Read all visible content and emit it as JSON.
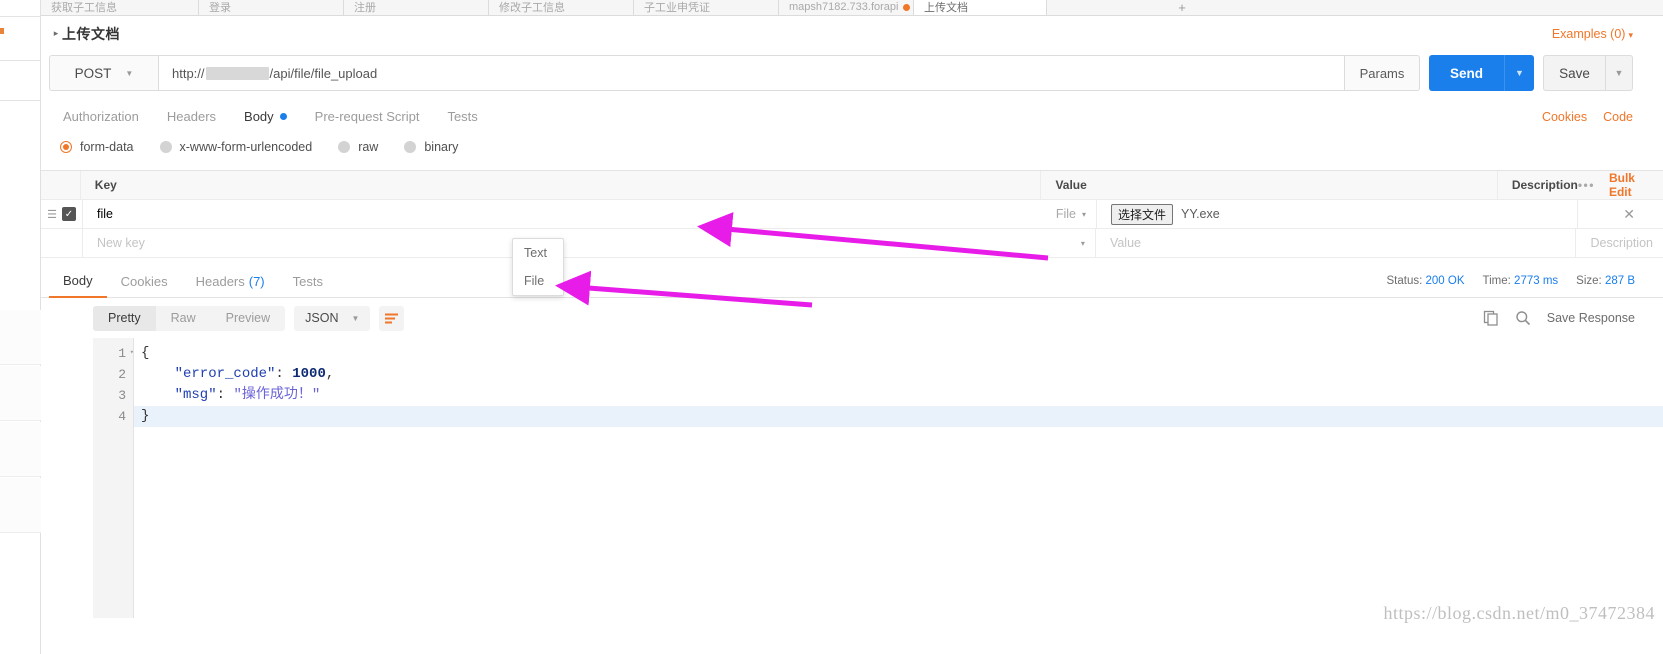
{
  "tabstrip": {
    "tabs": [
      {
        "label": "获取子工信息",
        "active": false,
        "dirty": false
      },
      {
        "label": "登录",
        "active": false,
        "dirty": false
      },
      {
        "label": "注册",
        "active": false,
        "dirty": false
      },
      {
        "label": "修改子工信息",
        "active": false,
        "dirty": false
      },
      {
        "label": "子工业申凭证",
        "active": false,
        "dirty": false
      },
      {
        "label": "mapsh7182.733.forapi",
        "active": false,
        "dirty": true
      },
      {
        "label": "上传文档",
        "active": true,
        "dirty": false
      }
    ],
    "add_tab_label": "+"
  },
  "request": {
    "title": "上传文档",
    "collapse_caret": "▸",
    "examples_label": "Examples (0)",
    "examples_caret": "▾",
    "method": "POST",
    "url_prefix": "http://",
    "url_suffix": "/api/file/file_upload",
    "params_label": "Params",
    "send_label": "Send",
    "save_label": "Save",
    "tabs": [
      {
        "label": "Authorization",
        "active": false,
        "dot": false
      },
      {
        "label": "Headers",
        "active": false,
        "dot": false
      },
      {
        "label": "Body",
        "active": true,
        "dot": true
      },
      {
        "label": "Pre-request Script",
        "active": false,
        "dot": false
      },
      {
        "label": "Tests",
        "active": false,
        "dot": false
      }
    ],
    "cookies_label": "Cookies",
    "code_label": "Code",
    "body_types": [
      {
        "label": "form-data",
        "selected": true
      },
      {
        "label": "x-www-form-urlencoded",
        "selected": false
      },
      {
        "label": "raw",
        "selected": false
      },
      {
        "label": "binary",
        "selected": false
      }
    ]
  },
  "kv_table": {
    "headers": {
      "key": "Key",
      "value": "Value",
      "description": "Description"
    },
    "more_dots": "•••",
    "bulk_edit_label": "Bulk Edit",
    "rows": [
      {
        "checked": true,
        "grip": "☰",
        "key": "file",
        "type": "File",
        "type_caret": "▾",
        "file_button_label": "选择文件",
        "file_name": "YY.exe",
        "description": "",
        "remove_label": "✕"
      }
    ],
    "new_row": {
      "key_placeholder": "New key",
      "value_placeholder": "Value",
      "description_placeholder": "Description",
      "type_caret": "▾"
    },
    "type_menu": {
      "open": true,
      "options": [
        {
          "label": "Text",
          "selected": false
        },
        {
          "label": "File",
          "selected": true
        }
      ]
    }
  },
  "response": {
    "tabs": [
      {
        "label": "Body",
        "count": "",
        "active": true
      },
      {
        "label": "Cookies",
        "count": "",
        "active": false
      },
      {
        "label": "Headers",
        "count": "(7)",
        "active": false
      },
      {
        "label": "Tests",
        "count": "",
        "active": false
      }
    ],
    "status_label": "Status:",
    "status_value": "200 OK",
    "time_label": "Time:",
    "time_value": "2773 ms",
    "size_label": "Size:",
    "size_value": "287 B",
    "view_modes": [
      {
        "label": "Pretty",
        "active": true
      },
      {
        "label": "Raw",
        "active": false
      },
      {
        "label": "Preview",
        "active": false
      }
    ],
    "format": "JSON",
    "format_caret": "▾",
    "wrap_icon": "wrap-lines-icon",
    "copy_icon": "copy-icon",
    "search_icon": "search-icon",
    "save_response_label": "Save Response",
    "code": {
      "lines": [
        {
          "num": "1",
          "fold": "▾",
          "highlight": false,
          "tokens": [
            {
              "t": "{",
              "c": "punc"
            }
          ]
        },
        {
          "num": "2",
          "fold": "",
          "highlight": false,
          "tokens": [
            {
              "t": "    \"error_code\"",
              "c": "key"
            },
            {
              "t": ": ",
              "c": "punc"
            },
            {
              "t": "1000",
              "c": "num"
            },
            {
              "t": ",",
              "c": "punc"
            }
          ]
        },
        {
          "num": "3",
          "fold": "",
          "highlight": false,
          "tokens": [
            {
              "t": "    \"msg\"",
              "c": "key"
            },
            {
              "t": ": ",
              "c": "punc"
            },
            {
              "t": "\"操作成功！\"",
              "c": "str"
            }
          ]
        },
        {
          "num": "4",
          "fold": "",
          "highlight": true,
          "tokens": [
            {
              "t": "}",
              "c": "punc"
            }
          ]
        }
      ]
    }
  },
  "watermark": "https://blog.csdn.net/m0_37472384",
  "colors": {
    "accent_orange": "#f0762a",
    "primary_blue": "#1a7eeb",
    "annotation_magenta": "#e81ce8"
  }
}
